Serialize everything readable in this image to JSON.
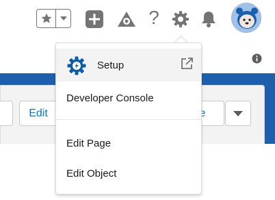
{
  "header": {
    "favorites_icon": "star-icon",
    "favorites_menu_icon": "chevron-down-icon",
    "add_icon": "plus-icon",
    "trailhead_icon": "trailhead-icon",
    "help_label": "?",
    "setup_icon": "gear-icon",
    "notifications_icon": "bell-icon",
    "avatar_icon": "astro-avatar"
  },
  "page": {
    "info_icon": "info-icon",
    "edit_label": "Edit",
    "partial_button_label": "te",
    "more_actions_icon": "chevron-down-icon"
  },
  "setup_menu": {
    "items": [
      {
        "label": "Setup",
        "icon": "gear-icon",
        "trailing_icon": "external-link-icon"
      },
      {
        "label": "Developer Console"
      },
      {
        "label": "Edit Page"
      },
      {
        "label": "Edit Object"
      }
    ]
  },
  "colors": {
    "brand_blue": "#0176d3",
    "banner_blue": "#1b5fad",
    "icon_gray": "#747474",
    "setup_gear": "#0b5cab"
  }
}
